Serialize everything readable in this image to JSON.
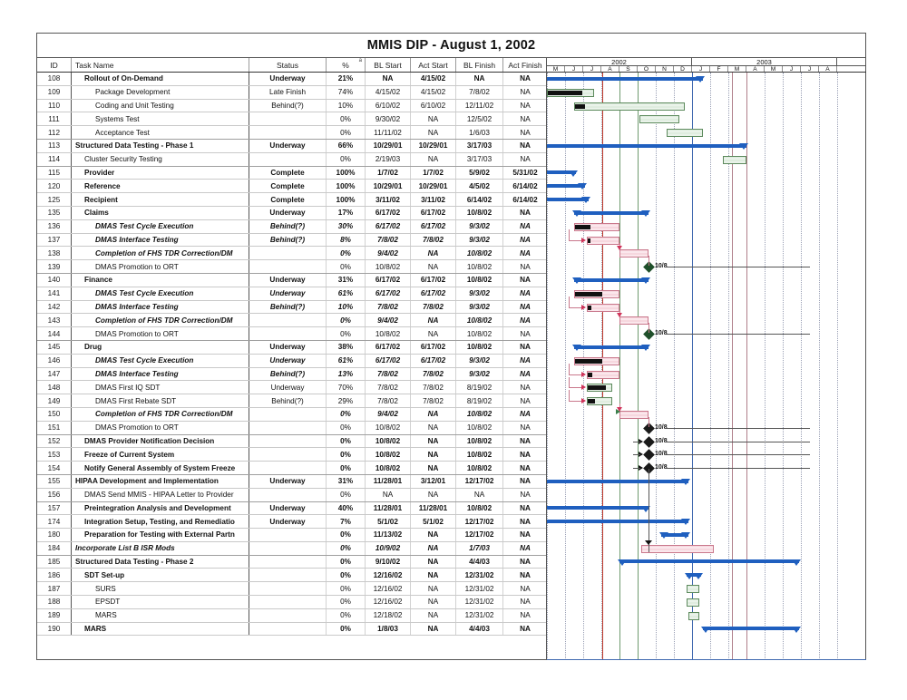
{
  "document": {
    "title": "MMIS DIP - August 1, 2002"
  },
  "table": {
    "columns": [
      "ID",
      "Task Name",
      "Status",
      "%",
      "BL Start",
      "Act Start",
      "BL Finish",
      "Act Finish"
    ],
    "pct_marker": "a",
    "rows": [
      {
        "id": "108",
        "task": "Rollout of On-Demand",
        "status": "Underway",
        "pct": "21%",
        "bl_start": "NA",
        "act_start": "4/15/02",
        "bl_finish": "NA",
        "act_finish": "NA",
        "style": "bold",
        "indent": 1
      },
      {
        "id": "109",
        "task": "Package Development",
        "status": "Late Finish",
        "pct": "74%",
        "bl_start": "4/15/02",
        "act_start": "4/15/02",
        "bl_finish": "7/8/02",
        "act_finish": "NA",
        "style": "normal",
        "indent": 2
      },
      {
        "id": "110",
        "task": "Coding and Unit Testing",
        "status": "Behind(?)",
        "pct": "10%",
        "bl_start": "6/10/02",
        "act_start": "6/10/02",
        "bl_finish": "12/11/02",
        "act_finish": "NA",
        "style": "normal",
        "indent": 2
      },
      {
        "id": "111",
        "task": "Systems Test",
        "status": "",
        "pct": "0%",
        "bl_start": "9/30/02",
        "act_start": "NA",
        "bl_finish": "12/5/02",
        "act_finish": "NA",
        "style": "normal",
        "indent": 2
      },
      {
        "id": "112",
        "task": "Acceptance Test",
        "status": "",
        "pct": "0%",
        "bl_start": "11/11/02",
        "act_start": "NA",
        "bl_finish": "1/6/03",
        "act_finish": "NA",
        "style": "normal",
        "indent": 2
      },
      {
        "id": "113",
        "task": "Structured Data Testing - Phase 1",
        "status": "Underway",
        "pct": "66%",
        "bl_start": "10/29/01",
        "act_start": "10/29/01",
        "bl_finish": "3/17/03",
        "act_finish": "NA",
        "style": "bold",
        "indent": 0
      },
      {
        "id": "114",
        "task": "Cluster Security Testing",
        "status": "",
        "pct": "0%",
        "bl_start": "2/19/03",
        "act_start": "NA",
        "bl_finish": "3/17/03",
        "act_finish": "NA",
        "style": "normal",
        "indent": 1
      },
      {
        "id": "115",
        "task": "Provider",
        "status": "Complete",
        "pct": "100%",
        "bl_start": "1/7/02",
        "act_start": "1/7/02",
        "bl_finish": "5/9/02",
        "act_finish": "5/31/02",
        "style": "bold",
        "indent": 1
      },
      {
        "id": "120",
        "task": "Reference",
        "status": "Complete",
        "pct": "100%",
        "bl_start": "10/29/01",
        "act_start": "10/29/01",
        "bl_finish": "4/5/02",
        "act_finish": "6/14/02",
        "style": "bold",
        "indent": 1
      },
      {
        "id": "125",
        "task": "Recipient",
        "status": "Complete",
        "pct": "100%",
        "bl_start": "3/11/02",
        "act_start": "3/11/02",
        "bl_finish": "6/14/02",
        "act_finish": "6/14/02",
        "style": "bold",
        "indent": 1
      },
      {
        "id": "135",
        "task": "Claims",
        "status": "Underway",
        "pct": "17%",
        "bl_start": "6/17/02",
        "act_start": "6/17/02",
        "bl_finish": "10/8/02",
        "act_finish": "NA",
        "style": "bold",
        "indent": 1
      },
      {
        "id": "136",
        "task": "DMAS Test Cycle Execution",
        "status": "Behind(?)",
        "pct": "30%",
        "bl_start": "6/17/02",
        "act_start": "6/17/02",
        "bl_finish": "9/3/02",
        "act_finish": "NA",
        "style": "red",
        "indent": 2
      },
      {
        "id": "137",
        "task": "DMAS Interface Testing",
        "status": "Behind(?)",
        "pct": "8%",
        "bl_start": "7/8/02",
        "act_start": "7/8/02",
        "bl_finish": "9/3/02",
        "act_finish": "NA",
        "style": "red",
        "indent": 2
      },
      {
        "id": "138",
        "task": "Completion of FHS TDR Correction/DM",
        "status": "",
        "pct": "0%",
        "bl_start": "9/4/02",
        "act_start": "NA",
        "bl_finish": "10/8/02",
        "act_finish": "NA",
        "style": "red",
        "indent": 2
      },
      {
        "id": "139",
        "task": "DMAS Promotion to ORT",
        "status": "",
        "pct": "0%",
        "bl_start": "10/8/02",
        "act_start": "NA",
        "bl_finish": "10/8/02",
        "act_finish": "NA",
        "style": "normal",
        "indent": 2
      },
      {
        "id": "140",
        "task": "Finance",
        "status": "Underway",
        "pct": "31%",
        "bl_start": "6/17/02",
        "act_start": "6/17/02",
        "bl_finish": "10/8/02",
        "act_finish": "NA",
        "style": "bold",
        "indent": 1
      },
      {
        "id": "141",
        "task": "DMAS Test Cycle Execution",
        "status": "Underway",
        "pct": "61%",
        "bl_start": "6/17/02",
        "act_start": "6/17/02",
        "bl_finish": "9/3/02",
        "act_finish": "NA",
        "style": "red",
        "indent": 2
      },
      {
        "id": "142",
        "task": "DMAS Interface Testing",
        "status": "Behind(?)",
        "pct": "10%",
        "bl_start": "7/8/02",
        "act_start": "7/8/02",
        "bl_finish": "9/3/02",
        "act_finish": "NA",
        "style": "red",
        "indent": 2
      },
      {
        "id": "143",
        "task": "Completion of FHS TDR Correction/DM",
        "status": "",
        "pct": "0%",
        "bl_start": "9/4/02",
        "act_start": "NA",
        "bl_finish": "10/8/02",
        "act_finish": "NA",
        "style": "red",
        "indent": 2
      },
      {
        "id": "144",
        "task": "DMAS Promotion to ORT",
        "status": "",
        "pct": "0%",
        "bl_start": "10/8/02",
        "act_start": "NA",
        "bl_finish": "10/8/02",
        "act_finish": "NA",
        "style": "normal",
        "indent": 2
      },
      {
        "id": "145",
        "task": "Drug",
        "status": "Underway",
        "pct": "38%",
        "bl_start": "6/17/02",
        "act_start": "6/17/02",
        "bl_finish": "10/8/02",
        "act_finish": "NA",
        "style": "bold",
        "indent": 1
      },
      {
        "id": "146",
        "task": "DMAS Test Cycle Execution",
        "status": "Underway",
        "pct": "61%",
        "bl_start": "6/17/02",
        "act_start": "6/17/02",
        "bl_finish": "9/3/02",
        "act_finish": "NA",
        "style": "red",
        "indent": 2
      },
      {
        "id": "147",
        "task": "DMAS Interface Testing",
        "status": "Behind(?)",
        "pct": "13%",
        "bl_start": "7/8/02",
        "act_start": "7/8/02",
        "bl_finish": "9/3/02",
        "act_finish": "NA",
        "style": "red",
        "indent": 2
      },
      {
        "id": "148",
        "task": "DMAS First IQ SDT",
        "status": "Underway",
        "pct": "70%",
        "bl_start": "7/8/02",
        "act_start": "7/8/02",
        "bl_finish": "8/19/02",
        "act_finish": "NA",
        "style": "normal",
        "indent": 2
      },
      {
        "id": "149",
        "task": "DMAS First Rebate SDT",
        "status": "Behind(?)",
        "pct": "29%",
        "bl_start": "7/8/02",
        "act_start": "7/8/02",
        "bl_finish": "8/19/02",
        "act_finish": "NA",
        "style": "normal",
        "indent": 2
      },
      {
        "id": "150",
        "task": "Completion of FHS TDR Correction/DM",
        "status": "",
        "pct": "0%",
        "bl_start": "9/4/02",
        "act_start": "NA",
        "bl_finish": "10/8/02",
        "act_finish": "NA",
        "style": "red",
        "indent": 2
      },
      {
        "id": "151",
        "task": "DMAS Promotion to ORT",
        "status": "",
        "pct": "0%",
        "bl_start": "10/8/02",
        "act_start": "NA",
        "bl_finish": "10/8/02",
        "act_finish": "NA",
        "style": "normal",
        "indent": 2
      },
      {
        "id": "152",
        "task": "DMAS Provider Notification Decision",
        "status": "",
        "pct": "0%",
        "bl_start": "10/8/02",
        "act_start": "NA",
        "bl_finish": "10/8/02",
        "act_finish": "NA",
        "style": "bold",
        "indent": 1
      },
      {
        "id": "153",
        "task": "Freeze of Current System",
        "status": "",
        "pct": "0%",
        "bl_start": "10/8/02",
        "act_start": "NA",
        "bl_finish": "10/8/02",
        "act_finish": "NA",
        "style": "bold",
        "indent": 1
      },
      {
        "id": "154",
        "task": "Notify General Assembly of System Freeze",
        "status": "",
        "pct": "0%",
        "bl_start": "10/8/02",
        "act_start": "NA",
        "bl_finish": "10/8/02",
        "act_finish": "NA",
        "style": "bold",
        "indent": 1
      },
      {
        "id": "155",
        "task": "HIPAA Development and Implementation",
        "status": "Underway",
        "pct": "31%",
        "bl_start": "11/28/01",
        "act_start": "3/12/01",
        "bl_finish": "12/17/02",
        "act_finish": "NA",
        "style": "bold",
        "indent": 0
      },
      {
        "id": "156",
        "task": "DMAS Send MMIS - HIPAA Letter to Provider",
        "status": "",
        "pct": "0%",
        "bl_start": "NA",
        "act_start": "NA",
        "bl_finish": "NA",
        "act_finish": "NA",
        "style": "gray",
        "indent": 1
      },
      {
        "id": "157",
        "task": "Preintegration Analysis and Development",
        "status": "Underway",
        "pct": "40%",
        "bl_start": "11/28/01",
        "act_start": "11/28/01",
        "bl_finish": "10/8/02",
        "act_finish": "NA",
        "style": "bold",
        "indent": 1
      },
      {
        "id": "174",
        "task": "Integration Setup, Testing, and Remediatio",
        "status": "Underway",
        "pct": "7%",
        "bl_start": "5/1/02",
        "act_start": "5/1/02",
        "bl_finish": "12/17/02",
        "act_finish": "NA",
        "style": "bold",
        "indent": 1
      },
      {
        "id": "180",
        "task": "Preparation for Testing with External Partn",
        "status": "",
        "pct": "0%",
        "bl_start": "11/13/02",
        "act_start": "NA",
        "bl_finish": "12/17/02",
        "act_finish": "NA",
        "style": "bold",
        "indent": 1
      },
      {
        "id": "184",
        "task": "Incorporate List B ISR Mods",
        "status": "",
        "pct": "0%",
        "bl_start": "10/9/02",
        "act_start": "NA",
        "bl_finish": "1/7/03",
        "act_finish": "NA",
        "style": "red",
        "indent": 0
      },
      {
        "id": "185",
        "task": "Structured Data Testing - Phase 2",
        "status": "",
        "pct": "0%",
        "bl_start": "9/10/02",
        "act_start": "NA",
        "bl_finish": "4/4/03",
        "act_finish": "NA",
        "style": "bold",
        "indent": 0
      },
      {
        "id": "186",
        "task": "SDT Set-up",
        "status": "",
        "pct": "0%",
        "bl_start": "12/16/02",
        "act_start": "NA",
        "bl_finish": "12/31/02",
        "act_finish": "NA",
        "style": "bold",
        "indent": 1
      },
      {
        "id": "187",
        "task": "SURS",
        "status": "",
        "pct": "0%",
        "bl_start": "12/16/02",
        "act_start": "NA",
        "bl_finish": "12/31/02",
        "act_finish": "NA",
        "style": "normal",
        "indent": 2
      },
      {
        "id": "188",
        "task": "EPSDT",
        "status": "",
        "pct": "0%",
        "bl_start": "12/16/02",
        "act_start": "NA",
        "bl_finish": "12/31/02",
        "act_finish": "NA",
        "style": "normal",
        "indent": 2
      },
      {
        "id": "189",
        "task": "MARS",
        "status": "",
        "pct": "0%",
        "bl_start": "12/18/02",
        "act_start": "NA",
        "bl_finish": "12/31/02",
        "act_finish": "NA",
        "style": "normal",
        "indent": 2
      },
      {
        "id": "190",
        "task": "MARS",
        "status": "",
        "pct": "0%",
        "bl_start": "1/8/03",
        "act_start": "NA",
        "bl_finish": "4/4/03",
        "act_finish": "NA",
        "style": "bold",
        "indent": 1
      }
    ]
  },
  "timeline": {
    "years": [
      {
        "label": "2002",
        "months": [
          "M",
          "J",
          "J",
          "A",
          "S",
          "O",
          "N",
          "D"
        ]
      },
      {
        "label": "2003",
        "months": [
          "J",
          "F",
          "M",
          "A",
          "M",
          "J",
          "J",
          "A"
        ]
      }
    ]
  },
  "chart_data": {
    "type": "bar",
    "title": "MMIS DIP - August 1, 2002",
    "subtype": "gantt",
    "x_axis_months": [
      "2002-M",
      "2002-J",
      "2002-J",
      "2002-A",
      "2002-S",
      "2002-O",
      "2002-N",
      "2002-D",
      "2003-J",
      "2003-F",
      "2003-M",
      "2003-A",
      "2003-M",
      "2003-J",
      "2003-J",
      "2003-A"
    ],
    "milestone_labels": [
      "10/8",
      "10/8",
      "10/8",
      "10/8",
      "10/8",
      "10/8"
    ],
    "colors": {
      "summary_bar": "#1f5fbf",
      "task_green": "#5d8a5d",
      "task_pink": "#c9788c",
      "progress": "#111111",
      "milestone": "#1a1a1a",
      "today_line": "#c0392b",
      "critical_text": "#d81b60"
    },
    "bars": [
      {
        "row": 0,
        "type": "summary",
        "start": 0,
        "end": 8.6
      },
      {
        "row": 1,
        "type": "green",
        "start": 0,
        "end": 2.6,
        "progress": 1.9
      },
      {
        "row": 2,
        "type": "green",
        "start": 1.5,
        "end": 7.6,
        "progress": 0.55
      },
      {
        "row": 3,
        "type": "green",
        "start": 5.1,
        "end": 7.3,
        "progress": 0
      },
      {
        "row": 4,
        "type": "green",
        "start": 6.6,
        "end": 8.6,
        "progress": 0
      },
      {
        "row": 5,
        "type": "summary",
        "start": 0,
        "end": 11.0
      },
      {
        "row": 6,
        "type": "green",
        "start": 9.7,
        "end": 11.0,
        "progress": 0
      },
      {
        "row": 7,
        "type": "summary",
        "start": 0,
        "end": 1.6
      },
      {
        "row": 8,
        "type": "summary",
        "start": 0,
        "end": 2.1
      },
      {
        "row": 9,
        "type": "summary",
        "start": 0,
        "end": 2.3
      },
      {
        "row": 10,
        "type": "summary",
        "start": 1.5,
        "end": 5.6
      },
      {
        "row": 11,
        "type": "pink",
        "start": 1.5,
        "end": 4.0,
        "progress": 0.85
      },
      {
        "row": 12,
        "type": "pink",
        "start": 2.2,
        "end": 4.0,
        "progress": 0.15
      },
      {
        "row": 13,
        "type": "pink",
        "start": 4.0,
        "end": 5.6,
        "progress": 0
      },
      {
        "row": 14,
        "type": "milestone",
        "at": 5.6,
        "label": "10/8"
      },
      {
        "row": 15,
        "type": "summary",
        "start": 1.5,
        "end": 5.6
      },
      {
        "row": 16,
        "type": "pink",
        "start": 1.5,
        "end": 4.0,
        "progress": 1.5
      },
      {
        "row": 17,
        "type": "pink",
        "start": 2.2,
        "end": 4.0,
        "progress": 0.18
      },
      {
        "row": 18,
        "type": "pink",
        "start": 4.0,
        "end": 5.6,
        "progress": 0
      },
      {
        "row": 19,
        "type": "milestone",
        "at": 5.6,
        "label": "10/8"
      },
      {
        "row": 20,
        "type": "summary",
        "start": 1.5,
        "end": 5.6
      },
      {
        "row": 21,
        "type": "pink",
        "start": 1.5,
        "end": 4.0,
        "progress": 1.5
      },
      {
        "row": 22,
        "type": "pink",
        "start": 2.2,
        "end": 4.0,
        "progress": 0.24
      },
      {
        "row": 23,
        "type": "green",
        "start": 2.2,
        "end": 3.6,
        "progress": 1.0
      },
      {
        "row": 24,
        "type": "green",
        "start": 2.2,
        "end": 3.6,
        "progress": 0.4
      },
      {
        "row": 25,
        "type": "pink",
        "start": 4.0,
        "end": 5.6,
        "progress": 0
      },
      {
        "row": 26,
        "type": "milestone",
        "at": 5.6,
        "label": "10/8"
      },
      {
        "row": 27,
        "type": "milestone",
        "at": 5.6,
        "label": "10/8"
      },
      {
        "row": 28,
        "type": "milestone",
        "at": 5.6,
        "label": "10/8"
      },
      {
        "row": 29,
        "type": "milestone",
        "at": 5.6,
        "label": "10/8"
      },
      {
        "row": 30,
        "type": "summary",
        "start": 0,
        "end": 7.8
      },
      {
        "row": 31,
        "type": "none"
      },
      {
        "row": 32,
        "type": "summary",
        "start": 0,
        "end": 5.6
      },
      {
        "row": 33,
        "type": "summary",
        "start": 0,
        "end": 7.8
      },
      {
        "row": 34,
        "type": "summary",
        "start": 6.3,
        "end": 7.8
      },
      {
        "row": 35,
        "type": "pink",
        "start": 5.2,
        "end": 9.2,
        "progress": 0
      },
      {
        "row": 36,
        "type": "summary",
        "start": 4.0,
        "end": 13.9
      },
      {
        "row": 37,
        "type": "summary",
        "start": 7.7,
        "end": 8.5
      },
      {
        "row": 38,
        "type": "green",
        "start": 7.7,
        "end": 8.4,
        "progress": 0
      },
      {
        "row": 39,
        "type": "green",
        "start": 7.7,
        "end": 8.4,
        "progress": 0
      },
      {
        "row": 40,
        "type": "green",
        "start": 7.8,
        "end": 8.4,
        "progress": 0
      },
      {
        "row": 41,
        "type": "summary",
        "start": 8.6,
        "end": 13.9
      }
    ]
  }
}
